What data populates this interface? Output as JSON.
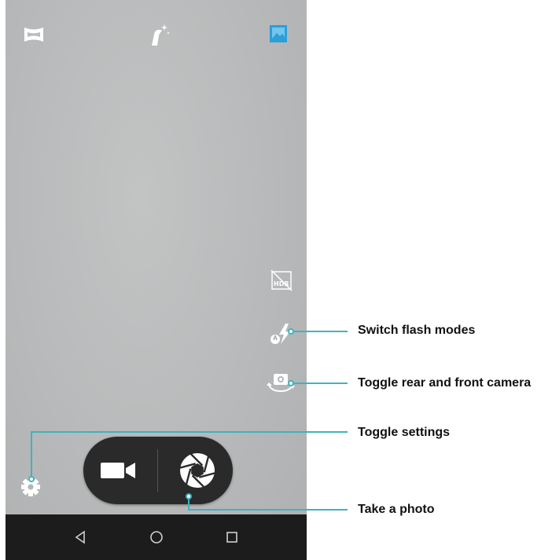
{
  "camera_screen": {
    "top_bar": {
      "left_icon": "panorama-mode-icon",
      "center_icon": "beauty-mode-icon",
      "right_icon": "gallery-thumbnail-icon"
    },
    "side_controls": {
      "hdr_icon": "hdr-off-icon",
      "hdr_text": "HDR",
      "flash_icon": "flash-auto-icon",
      "flash_badge": "A",
      "switch_camera_icon": "switch-camera-icon"
    },
    "settings_icon": "gear-icon",
    "capture_bar": {
      "video_icon": "video-camera-icon",
      "shutter_icon": "aperture-shutter-icon"
    },
    "navigation_bar": {
      "back_icon": "back-triangle-icon",
      "home_icon": "home-circle-icon",
      "recents_icon": "recents-square-icon"
    }
  },
  "callouts": {
    "switch_flash_modes": "Switch flash modes",
    "toggle_camera": "Toggle rear and front camera",
    "toggle_settings": "Toggle settings",
    "take_photo": "Take a photo"
  },
  "colors": {
    "callout_line": "#3fb3bd",
    "gallery_accent": "#2b9fd9",
    "navigation_bar": "#1c1c1c",
    "capture_bar": "#2a2a2a"
  }
}
